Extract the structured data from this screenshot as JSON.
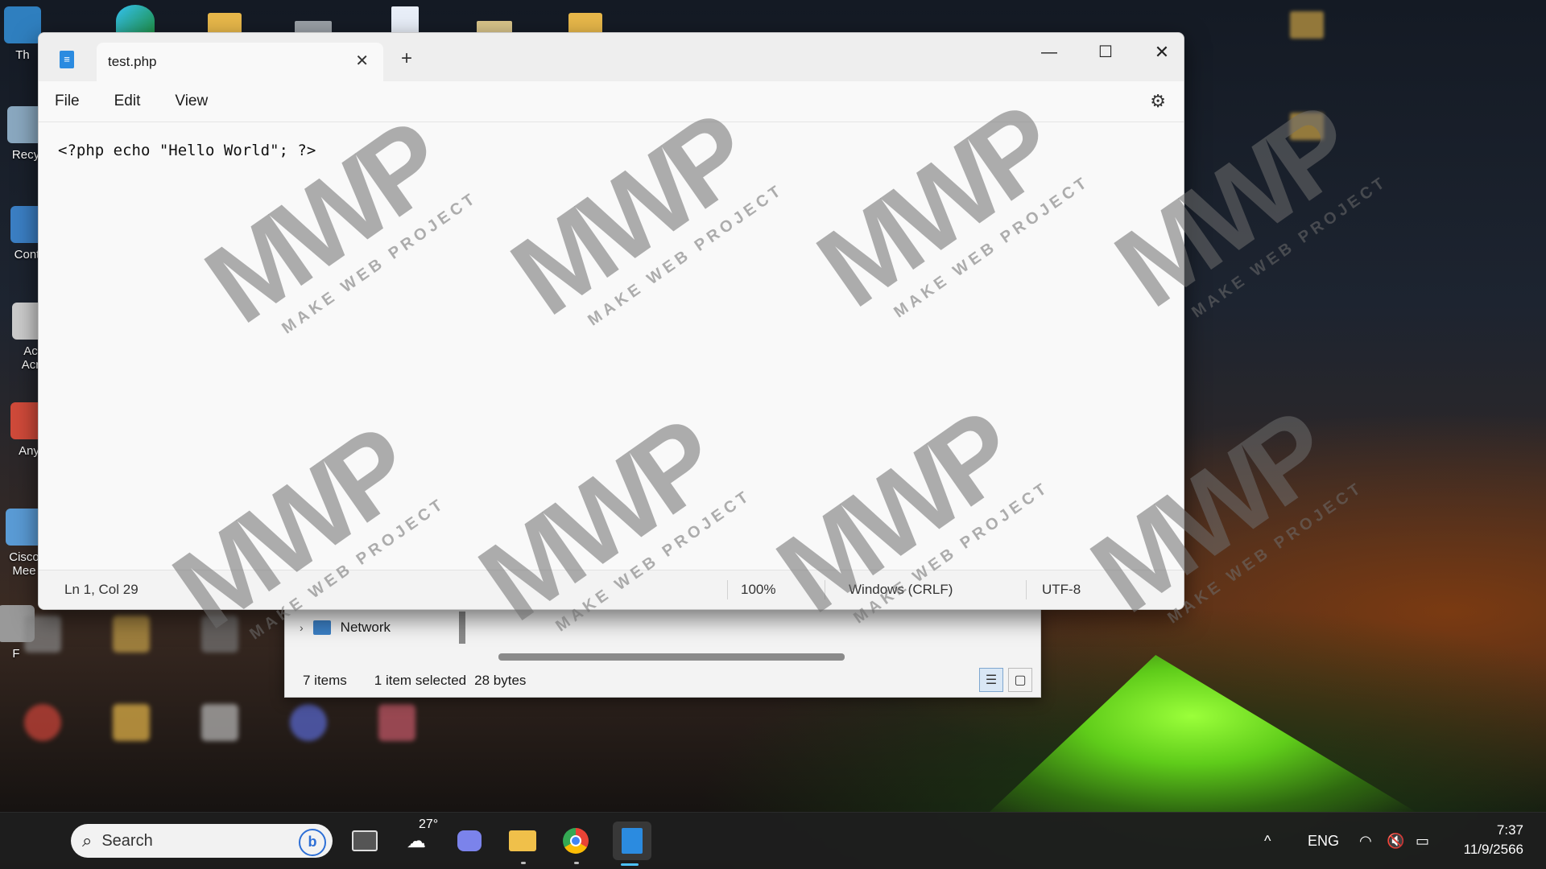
{
  "desktop": {
    "icons": [
      {
        "label": "Th",
        "color": "#2f7fbf"
      },
      {
        "label": "Recy",
        "color": "#8aa8c0"
      },
      {
        "label": "Contr",
        "color": "#3b7fc4"
      },
      {
        "label": "Ac",
        "color": "#cccccc"
      },
      {
        "label": "Acr",
        "color": "#cccccc"
      },
      {
        "label": "Any",
        "color": "#d04a3a"
      },
      {
        "label": "Cisco",
        "color": "#5a9bd5"
      },
      {
        "label": "Mee",
        "color": "#5a9bd5"
      },
      {
        "label": "F",
        "color": "#cccccc"
      }
    ]
  },
  "explorer": {
    "nav_item": "Network",
    "items_count": "7 items",
    "selection": "1 item selected",
    "size": "28 bytes"
  },
  "notepad": {
    "tab_title": "test.php",
    "menu": [
      "File",
      "Edit",
      "View"
    ],
    "content": "<?php echo \"Hello World\"; ?>",
    "status": {
      "position": "Ln 1, Col 29",
      "zoom": "100%",
      "line_ending": "Windows (CRLF)",
      "encoding": "UTF-8"
    }
  },
  "watermark": {
    "logo": "MWP",
    "tagline": "MAKE WEB PROJECT"
  },
  "taskbar": {
    "search_placeholder": "Search",
    "weather_temp": "27°",
    "language": "ENG",
    "time": "7:37",
    "date": "11/9/2566"
  },
  "colors": {
    "accent": "#4cc2ff",
    "windows_blue": "#3aa0f0"
  }
}
